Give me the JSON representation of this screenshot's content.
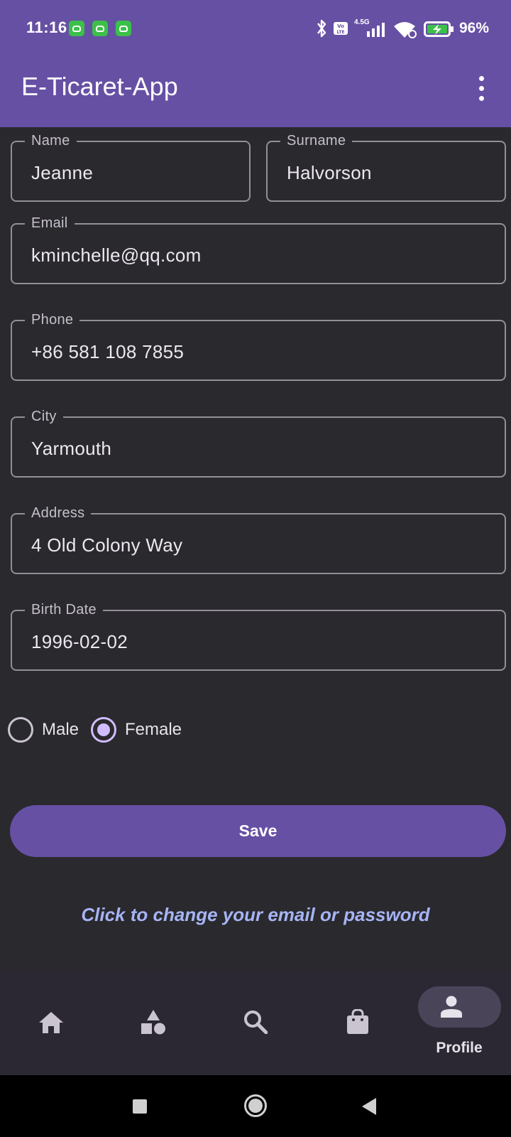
{
  "status_bar": {
    "time": "11:16",
    "battery_percent": "96%",
    "network": "4.5G",
    "icons": [
      "notification-cat-icon",
      "notification-cat-icon",
      "notification-cat-icon",
      "bluetooth-icon",
      "volte-icon",
      "signal-icon",
      "wifi-icon",
      "battery-charging-icon"
    ]
  },
  "app_bar": {
    "title": "E-Ticaret-App",
    "menu_icon": "more-vert-icon"
  },
  "form": {
    "name": {
      "label": "Name",
      "value": "Jeanne"
    },
    "surname": {
      "label": "Surname",
      "value": "Halvorson"
    },
    "email": {
      "label": "Email",
      "value": "kminchelle@qq.com"
    },
    "phone": {
      "label": "Phone",
      "value": "+86 581 108 7855"
    },
    "city": {
      "label": "City",
      "value": "Yarmouth"
    },
    "address": {
      "label": "Address",
      "value": "4 Old Colony Way"
    },
    "birth_date": {
      "label": "Birth Date",
      "value": "1996-02-02"
    },
    "gender": {
      "options": [
        "Male",
        "Female"
      ],
      "selected": "Female"
    }
  },
  "actions": {
    "save_label": "Save",
    "change_credentials_link": "Click to change your email or password"
  },
  "bottom_nav": {
    "items": [
      {
        "icon": "home-icon",
        "label": ""
      },
      {
        "icon": "categories-icon",
        "label": ""
      },
      {
        "icon": "search-icon",
        "label": ""
      },
      {
        "icon": "shopping-bag-icon",
        "label": ""
      },
      {
        "icon": "person-icon",
        "label": "Profile",
        "selected": true
      }
    ]
  },
  "colors": {
    "primary": "#6650a4",
    "background": "#2a292d",
    "outline": "#938f99",
    "radio_selected": "#d0bcff",
    "link": "#a6b4f5",
    "nav_background": "#2b2834"
  }
}
